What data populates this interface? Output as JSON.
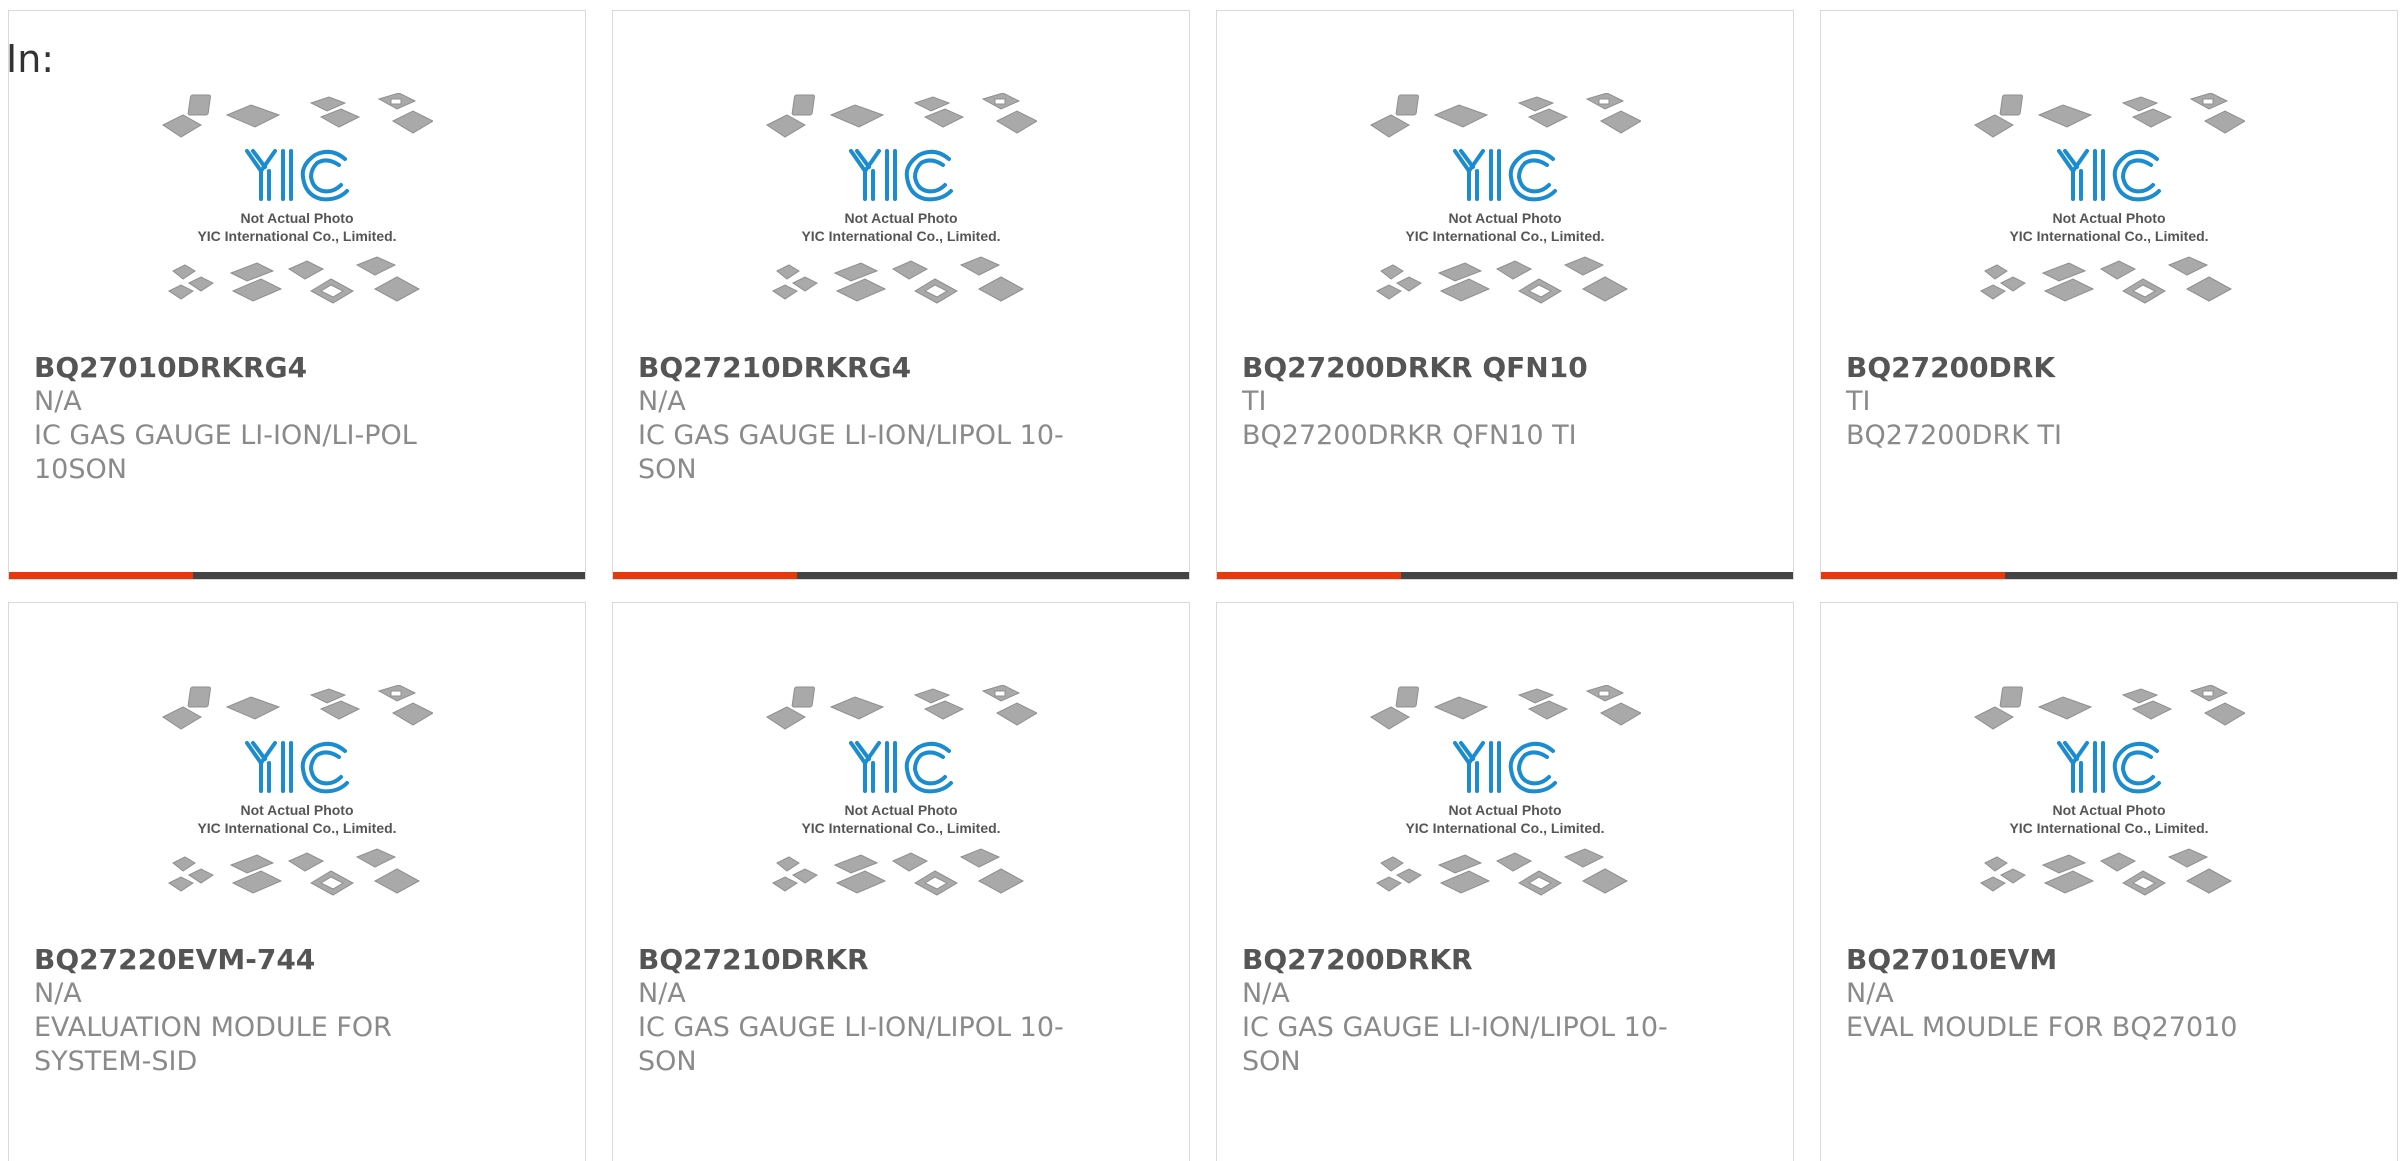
{
  "header": {
    "label": "In:"
  },
  "colors": {
    "accent": "#e8380d",
    "bar": "#444444",
    "logo": "#1a8ccf"
  },
  "photo": {
    "icon": "product-placeholder-icon",
    "logo_text": "YIC",
    "line1": "Not Actual Photo",
    "line2": "YIC International Co., Limited."
  },
  "products": [
    {
      "part": "BQ27010DRKRG4",
      "mfr": "N/A",
      "desc": "IC GAS GAUGE LI-ION/LI-POL 10SON",
      "bar_progress": 0.32
    },
    {
      "part": "BQ27210DRKRG4",
      "mfr": "N/A",
      "desc": "IC GAS GAUGE LI-ION/LIPOL 10-SON",
      "bar_progress": 0.32
    },
    {
      "part": "BQ27200DRKR QFN10",
      "mfr": "TI",
      "desc": "BQ27200DRKR QFN10 TI",
      "bar_progress": 0.32
    },
    {
      "part": "BQ27200DRK",
      "mfr": "TI",
      "desc": "BQ27200DRK TI",
      "bar_progress": 0.32
    },
    {
      "part": "BQ27220EVM-744",
      "mfr": "N/A",
      "desc": "EVALUATION MODULE FOR SYSTEM-SID",
      "bar_progress": 0.32
    },
    {
      "part": "BQ27210DRKR",
      "mfr": "N/A",
      "desc": "IC GAS GAUGE LI-ION/LIPOL 10-SON",
      "bar_progress": 0.32
    },
    {
      "part": "BQ27200DRKR",
      "mfr": "N/A",
      "desc": "IC GAS GAUGE LI-ION/LIPOL 10-SON",
      "bar_progress": 0.32
    },
    {
      "part": "BQ27010EVM",
      "mfr": "N/A",
      "desc": "EVAL MOUDLE FOR BQ27010",
      "bar_progress": 0.32
    }
  ]
}
